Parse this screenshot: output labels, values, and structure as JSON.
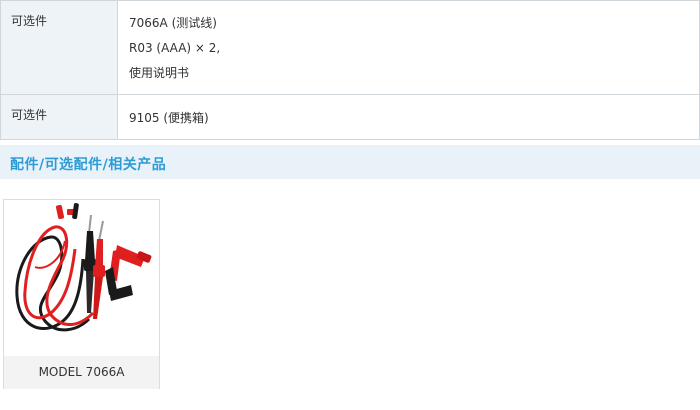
{
  "spec_table": {
    "rows": [
      {
        "label": "可选件",
        "lines": [
          "7066A (测试线)",
          "R03 (AAA) × 2,",
          "使用说明书"
        ]
      },
      {
        "label": "可选件",
        "lines": [
          "9105 (便携箱)"
        ]
      }
    ]
  },
  "section": {
    "title": "配件/可选配件/相关产品"
  },
  "products": [
    {
      "name": "MODEL 7066A",
      "image_icon": "test-leads-image"
    }
  ],
  "colors": {
    "accent": "#2d9cd6",
    "section_bg": "#e9f2f9",
    "label_bg": "#eef3f8",
    "lead_red": "#e02020",
    "lead_black": "#1a1a1a"
  }
}
